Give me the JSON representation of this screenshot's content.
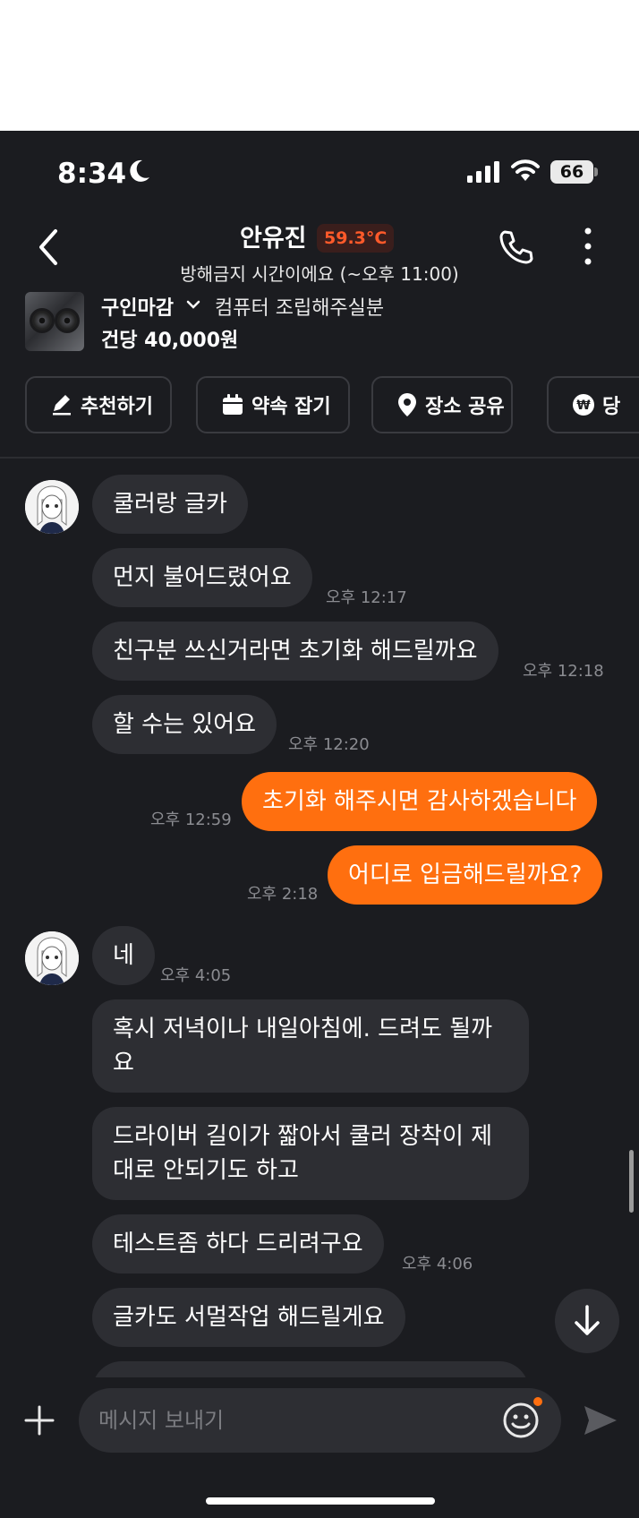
{
  "status_bar": {
    "time": "8:34",
    "battery": "66"
  },
  "header": {
    "name": "안유진",
    "temperature": "59.3°C",
    "subtitle": "방해금지 시간이에요 (~오후 11:00)"
  },
  "product": {
    "status": "구인마감",
    "title": "컴퓨터 조립해주실분",
    "price": "건당 40,000원"
  },
  "actions": [
    "추천하기",
    "약속 잡기",
    "장소 공유",
    "당"
  ],
  "messages": [
    {
      "from": "them",
      "text": "쿨러랑 글카",
      "time": ""
    },
    {
      "from": "them",
      "text": "먼지 불어드렸어요",
      "time": "오후 12:17"
    },
    {
      "from": "them",
      "text": "친구분 쓰신거라면 초기화 해드릴까요",
      "time": "오후 12:18"
    },
    {
      "from": "them",
      "text": "할 수는 있어요",
      "time": "오후 12:20"
    },
    {
      "from": "me",
      "text": "초기화 해주시면 감사하겠습니다",
      "time": "오후 12:59"
    },
    {
      "from": "me",
      "text": "어디로 입금해드릴까요?",
      "time": "오후 2:18"
    },
    {
      "from": "them",
      "text": "네",
      "time": "오후 4:05"
    },
    {
      "from": "them",
      "text": "혹시 저녁이나 내일아침에. 드려도 될까요",
      "time": ""
    },
    {
      "from": "them",
      "text": "드라이버 길이가 짧아서 쿨러 장착이 제대로 안되기도 하고",
      "time": ""
    },
    {
      "from": "them",
      "text": "테스트좀 하다 드리려구요",
      "time": "오후 4:06"
    },
    {
      "from": "them",
      "text": "글카도 서멀작업 해드릴게요",
      "time": ""
    }
  ],
  "composer": {
    "placeholder": "메시지 보내기"
  },
  "colors": {
    "background": "#1b1c20",
    "bubble_in": "#2d2e33",
    "bubble_out": "#ff6f0f",
    "temperature": "#ff5a2a"
  }
}
